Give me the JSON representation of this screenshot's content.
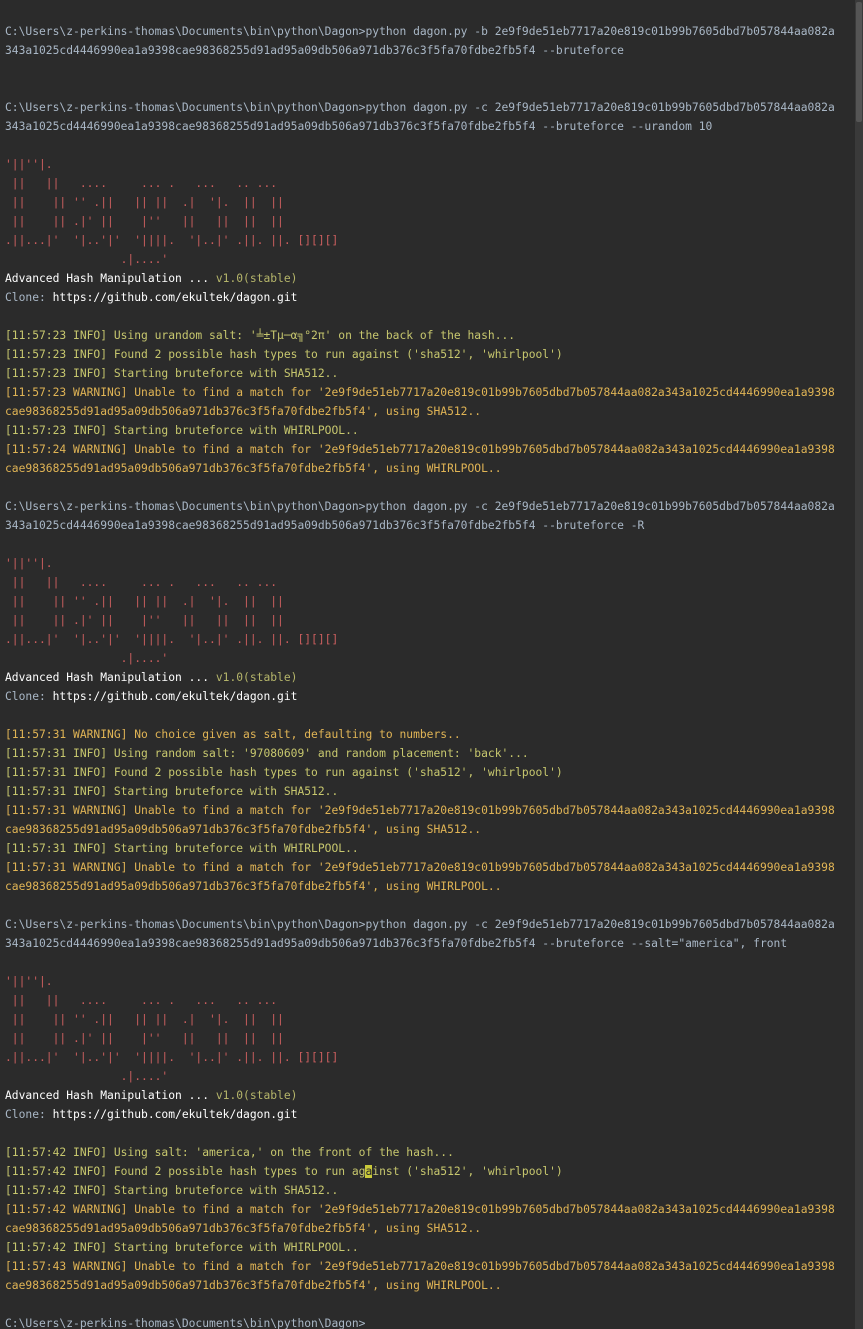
{
  "colors": {
    "background": "#2b2b2b",
    "prompt": "#a9b7c6",
    "banner": "#cc5f5f",
    "info": "#c7c76e",
    "warning": "#e0b455",
    "white": "#ffffff",
    "cursor": "#c9c93a"
  },
  "banner": {
    "l1": "'||''|.",
    "l2": " ||   ||   ....     ... .   ...   .. ...",
    "l3": " ||    || '' .||   || ||  .|  '|.  ||  ||",
    "l4": " ||    || .|' ||    |''   ||   ||  ||  ||",
    "l5": ".||...|'  '|..'|'  '||||.  '|..|' .||. ||. [][][]",
    "l6": "                 .|....'",
    "title": "Advanced Hash Manipulation ... ",
    "version": "v1.0(stable)",
    "clone_label": "Clone: ",
    "clone_url": "https://github.com/ekultek/dagon.git"
  },
  "session1": {
    "cmd1": "C:\\Users\\z-perkins-thomas\\Documents\\bin\\python\\Dagon>python dagon.py -b 2e9f9de51eb7717a20e819c01b99b7605dbd7b057844aa082a",
    "cmd2": "343a1025cd4446990ea1a9398cae98368255d91ad95a09db506a971db376c3f5fa70fdbe2fb5f4 --bruteforce"
  },
  "session2": {
    "cmd1": "C:\\Users\\z-perkins-thomas\\Documents\\bin\\python\\Dagon>python dagon.py -c 2e9f9de51eb7717a20e819c01b99b7605dbd7b057844aa082a",
    "cmd2": "343a1025cd4446990ea1a9398cae98368255d91ad95a09db506a971db376c3f5fa70fdbe2fb5f4 --bruteforce --urandom 10",
    "log": [
      "[11:57:23 INFO] Using urandom salt: '╧±Tμ─α╗°2π' on the back of the hash...",
      "[11:57:23 INFO] Found 2 possible hash types to run against ('sha512', 'whirlpool')",
      "[11:57:23 INFO] Starting bruteforce with SHA512..",
      "[11:57:23 WARNING] Unable to find a match for '2e9f9de51eb7717a20e819c01b99b7605dbd7b057844aa082a343a1025cd4446990ea1a9398",
      "cae98368255d91ad95a09db506a971db376c3f5fa70fdbe2fb5f4', using SHA512..",
      "[11:57:23 INFO] Starting bruteforce with WHIRLPOOL..",
      "[11:57:24 WARNING] Unable to find a match for '2e9f9de51eb7717a20e819c01b99b7605dbd7b057844aa082a343a1025cd4446990ea1a9398",
      "cae98368255d91ad95a09db506a971db376c3f5fa70fdbe2fb5f4', using WHIRLPOOL.."
    ]
  },
  "session3": {
    "cmd1": "C:\\Users\\z-perkins-thomas\\Documents\\bin\\python\\Dagon>python dagon.py -c 2e9f9de51eb7717a20e819c01b99b7605dbd7b057844aa082a",
    "cmd2": "343a1025cd4446990ea1a9398cae98368255d91ad95a09db506a971db376c3f5fa70fdbe2fb5f4 --bruteforce -R",
    "log": [
      "[11:57:31 WARNING] No choice given as salt, defaulting to numbers..",
      "[11:57:31 INFO] Using random salt: '97080609' and random placement: 'back'...",
      "[11:57:31 INFO] Found 2 possible hash types to run against ('sha512', 'whirlpool')",
      "[11:57:31 INFO] Starting bruteforce with SHA512..",
      "[11:57:31 WARNING] Unable to find a match for '2e9f9de51eb7717a20e819c01b99b7605dbd7b057844aa082a343a1025cd4446990ea1a9398",
      "cae98368255d91ad95a09db506a971db376c3f5fa70fdbe2fb5f4', using SHA512..",
      "[11:57:31 INFO] Starting bruteforce with WHIRLPOOL..",
      "[11:57:31 WARNING] Unable to find a match for '2e9f9de51eb7717a20e819c01b99b7605dbd7b057844aa082a343a1025cd4446990ea1a9398",
      "cae98368255d91ad95a09db506a971db376c3f5fa70fdbe2fb5f4', using WHIRLPOOL.."
    ]
  },
  "session4": {
    "cmd1": "C:\\Users\\z-perkins-thomas\\Documents\\bin\\python\\Dagon>python dagon.py -c 2e9f9de51eb7717a20e819c01b99b7605dbd7b057844aa082a",
    "cmd2": "343a1025cd4446990ea1a9398cae98368255d91ad95a09db506a971db376c3f5fa70fdbe2fb5f4 --bruteforce --salt=\"america\", front",
    "log1": "[11:57:42 INFO] Using salt: 'america,' on the front of the hash...",
    "log2_a": "[11:57:42 INFO] Found 2 possible hash types to run ag",
    "log2_cursor": "a",
    "log2_b": "inst ('sha512', 'whirlpool')",
    "log_rest": [
      "[11:57:42 INFO] Starting bruteforce with SHA512..",
      "[11:57:42 WARNING] Unable to find a match for '2e9f9de51eb7717a20e819c01b99b7605dbd7b057844aa082a343a1025cd4446990ea1a9398",
      "cae98368255d91ad95a09db506a971db376c3f5fa70fdbe2fb5f4', using SHA512..",
      "[11:57:42 INFO] Starting bruteforce with WHIRLPOOL..",
      "[11:57:43 WARNING] Unable to find a match for '2e9f9de51eb7717a20e819c01b99b7605dbd7b057844aa082a343a1025cd4446990ea1a9398",
      "cae98368255d91ad95a09db506a971db376c3f5fa70fdbe2fb5f4', using WHIRLPOOL.."
    ]
  },
  "final_prompt": "C:\\Users\\z-perkins-thomas\\Documents\\bin\\python\\Dagon>"
}
